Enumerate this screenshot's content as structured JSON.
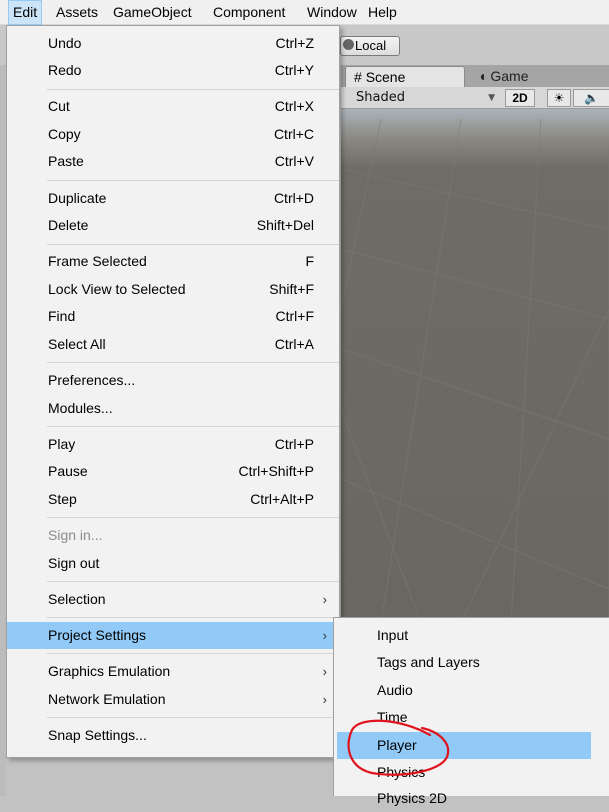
{
  "menubar": {
    "items": [
      "Edit",
      "Assets",
      "GameObject",
      "Component",
      "Window",
      "Help"
    ]
  },
  "toolbar": {
    "local_label": "Local"
  },
  "scene_view": {
    "tabs": [
      {
        "label": "Scene",
        "icon": "hash-icon"
      },
      {
        "label": "Game",
        "icon": "pacman-icon"
      }
    ],
    "shading_mode": "Shaded",
    "btn_2d": "2D",
    "lighting_icon": "sun-icon",
    "audio_icon": "speaker-icon"
  },
  "edit_menu": {
    "items": [
      {
        "label": "Undo",
        "shortcut": "Ctrl+Z"
      },
      {
        "label": "Redo",
        "shortcut": "Ctrl+Y"
      },
      {
        "label": "Cut",
        "shortcut": "Ctrl+X"
      },
      {
        "label": "Copy",
        "shortcut": "Ctrl+C"
      },
      {
        "label": "Paste",
        "shortcut": "Ctrl+V"
      },
      {
        "label": "Duplicate",
        "shortcut": "Ctrl+D"
      },
      {
        "label": "Delete",
        "shortcut": "Shift+Del"
      },
      {
        "label": "Frame Selected",
        "shortcut": "F"
      },
      {
        "label": "Lock View to Selected",
        "shortcut": "Shift+F"
      },
      {
        "label": "Find",
        "shortcut": "Ctrl+F"
      },
      {
        "label": "Select All",
        "shortcut": "Ctrl+A"
      },
      {
        "label": "Preferences...",
        "shortcut": ""
      },
      {
        "label": "Modules...",
        "shortcut": ""
      },
      {
        "label": "Play",
        "shortcut": "Ctrl+P"
      },
      {
        "label": "Pause",
        "shortcut": "Ctrl+Shift+P"
      },
      {
        "label": "Step",
        "shortcut": "Ctrl+Alt+P"
      },
      {
        "label": "Sign in...",
        "shortcut": "",
        "disabled": true
      },
      {
        "label": "Sign out",
        "shortcut": ""
      },
      {
        "label": "Selection",
        "shortcut": "",
        "submenu": true
      },
      {
        "label": "Project Settings",
        "shortcut": "",
        "submenu": true,
        "highlighted": true
      },
      {
        "label": "Graphics Emulation",
        "shortcut": "",
        "submenu": true
      },
      {
        "label": "Network Emulation",
        "shortcut": "",
        "submenu": true
      },
      {
        "label": "Snap Settings...",
        "shortcut": ""
      }
    ],
    "submenu_arrow": "›"
  },
  "project_settings_submenu": {
    "items": [
      {
        "label": "Input"
      },
      {
        "label": "Tags and Layers"
      },
      {
        "label": "Audio"
      },
      {
        "label": "Time"
      },
      {
        "label": "Player",
        "highlighted": true
      },
      {
        "label": "Physics"
      },
      {
        "label": "Physics 2D"
      }
    ]
  },
  "colors": {
    "highlight": "#91c9f7",
    "annotation": "#e0141e"
  }
}
